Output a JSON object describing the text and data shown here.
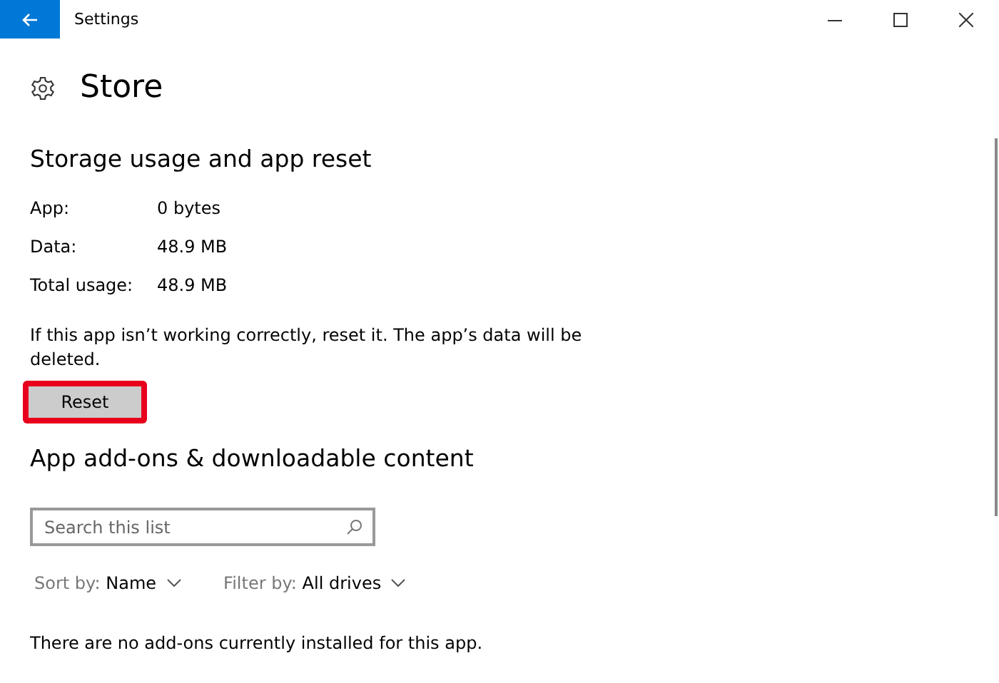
{
  "window": {
    "title": "Settings"
  },
  "page": {
    "title": "Store"
  },
  "storage": {
    "heading": "Storage usage and app reset",
    "rows": [
      {
        "label": "App:",
        "value": "0 bytes"
      },
      {
        "label": "Data:",
        "value": "48.9 MB"
      },
      {
        "label": "Total usage:",
        "value": "48.9 MB"
      }
    ],
    "description": "If this app isn’t working correctly, reset it. The app’s data will be deleted.",
    "reset_button": {
      "label": "Reset",
      "highlighted": true
    }
  },
  "addons": {
    "heading": "App add-ons & downloadable content",
    "search": {
      "placeholder": "Search this list"
    },
    "sort": {
      "prefix": "Sort by:",
      "value": "Name"
    },
    "filter": {
      "prefix": "Filter by:",
      "value": "All drives"
    },
    "message": "There are no add-ons currently installed for this app."
  }
}
